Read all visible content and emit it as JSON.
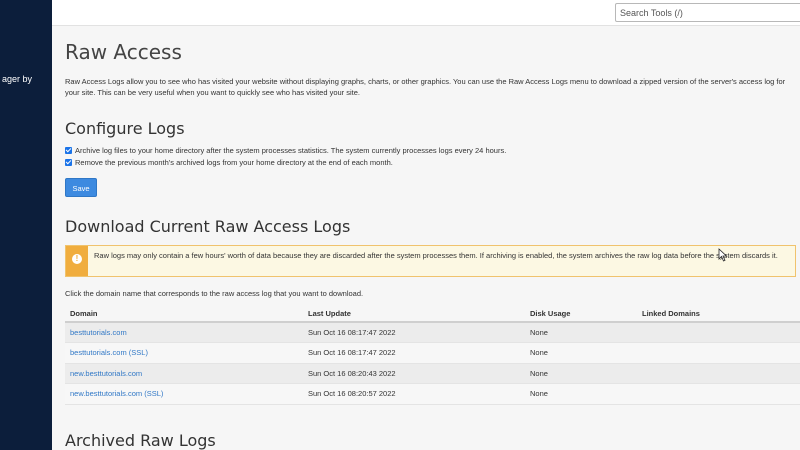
{
  "sidebar": {
    "partial_text": "ager by"
  },
  "topbar": {
    "search_placeholder": "Search Tools (/)"
  },
  "page": {
    "title": "Raw Access",
    "description": "Raw Access Logs allow you to see who has visited your website without displaying graphs, charts, or other graphics. You can use the Raw Access Logs menu to download a zipped version of the server's access log for your site. This can be very useful when you want to quickly see who has visited your site."
  },
  "configure": {
    "heading": "Configure Logs",
    "options": [
      {
        "label": "Archive log files to your home directory after the system processes statistics. The system currently processes logs every 24 hours.",
        "checked": true
      },
      {
        "label": "Remove the previous month's archived logs from your home directory at the end of each month.",
        "checked": true
      }
    ],
    "save_label": "Save"
  },
  "download": {
    "heading": "Download Current Raw Access Logs",
    "alert_icon": "exclamation-icon",
    "alert_text": "Raw logs may only contain a few hours' worth of data because they are discarded after the system processes them. If archiving is enabled, the system archives the raw log data before the system discards it.",
    "instruction": "Click the domain name that corresponds to the raw access log that you want to download.",
    "columns": [
      "Domain",
      "Last Update",
      "Disk Usage",
      "Linked Domains"
    ],
    "rows": [
      {
        "domain": "besttutorials.com",
        "last_update": "Sun Oct 16 08:17:47 2022",
        "disk_usage": "None",
        "linked": ""
      },
      {
        "domain": "besttutorials.com (SSL)",
        "last_update": "Sun Oct 16 08:17:47 2022",
        "disk_usage": "None",
        "linked": ""
      },
      {
        "domain": "new.besttutorials.com",
        "last_update": "Sun Oct 16 08:20:43 2022",
        "disk_usage": "None",
        "linked": ""
      },
      {
        "domain": "new.besttutorials.com (SSL)",
        "last_update": "Sun Oct 16 08:20:57 2022",
        "disk_usage": "None",
        "linked": ""
      }
    ]
  },
  "archived": {
    "heading": "Archived Raw Logs"
  },
  "colors": {
    "sidebar": "#0c1e3b",
    "accent": "#3d8ae0",
    "link": "#3178c6",
    "alert_border": "#f0c36d",
    "alert_icon_bg": "#f0ad3e"
  }
}
